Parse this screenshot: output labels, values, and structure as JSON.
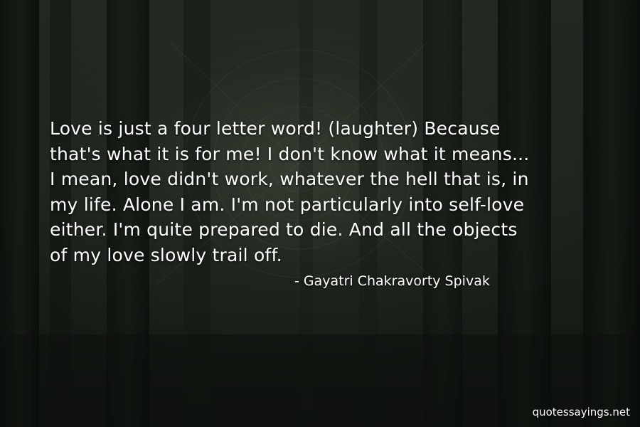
{
  "quote": {
    "lines": [
      "Love is just a four letter word! (laughter) Because",
      "that's what it is for me! I don't know what it means...",
      "I mean, love didn't work, whatever the hell that is, in",
      "my life. Alone I am. I'm not particularly into self-love",
      "either. I'm quite prepared to die. And all the objects",
      "of my love slowly trail off."
    ]
  },
  "author": "- Gayatri Chakravorty Spivak",
  "watermark": "quotessayings.net",
  "colors": {
    "text": "#ffffff",
    "background_top": "#2d352c",
    "background_bottom": "#141814"
  }
}
